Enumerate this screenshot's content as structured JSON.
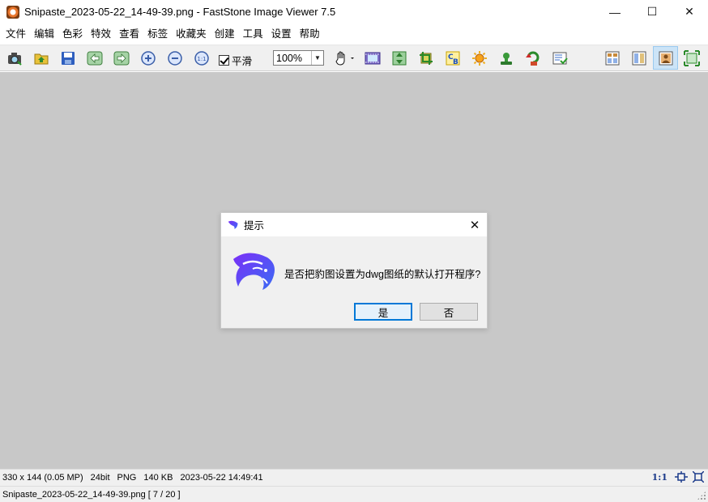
{
  "window": {
    "title": "Snipaste_2023-05-22_14-49-39.png  -  FastStone Image Viewer 7.5",
    "controls": {
      "minimize": "—",
      "maximize": "☐",
      "close": "✕"
    }
  },
  "menu": {
    "items": [
      "文件",
      "编辑",
      "色彩",
      "特效",
      "查看",
      "标签",
      "收藏夹",
      "创建",
      "工具",
      "设置",
      "帮助"
    ]
  },
  "toolbar": {
    "smooth_label": "平滑",
    "smooth_checked": true,
    "zoom_value": "100%",
    "icons": [
      "camera-icon",
      "open-folder-icon",
      "save-icon",
      "previous-icon",
      "next-icon",
      "zoom-in-icon",
      "zoom-out-icon",
      "actual-size-icon",
      "hand-tool-icon",
      "slideshow-icon",
      "resize-icon",
      "crop-icon",
      "color-adjust-icon",
      "brightness-icon",
      "stamp-icon",
      "undo-icon",
      "batch-icon",
      "browser-layout-icon",
      "thumbnail-layout-icon",
      "full-view-layout-icon",
      "fullscreen-icon"
    ]
  },
  "dialog": {
    "title": "提示",
    "message": "是否把豹图设置为dwg图纸的默认打开程序?",
    "yes_label": "是",
    "no_label": "否"
  },
  "status": {
    "dimensions": "330 x 144 (0.05 MP)",
    "bit_depth": "24bit",
    "format": "PNG",
    "file_size": "140 KB",
    "datetime": "2023-05-22 14:49:41",
    "ratio": "1:1",
    "filename": "Snipaste_2023-05-22_14-49-39.png [ 7 / 20 ]"
  },
  "colors": {
    "canvas_bg": "#c8c8c8",
    "accent": "#0078d7",
    "logo_gradient_start": "#7b2ff7",
    "logo_gradient_end": "#3a6cf4"
  }
}
